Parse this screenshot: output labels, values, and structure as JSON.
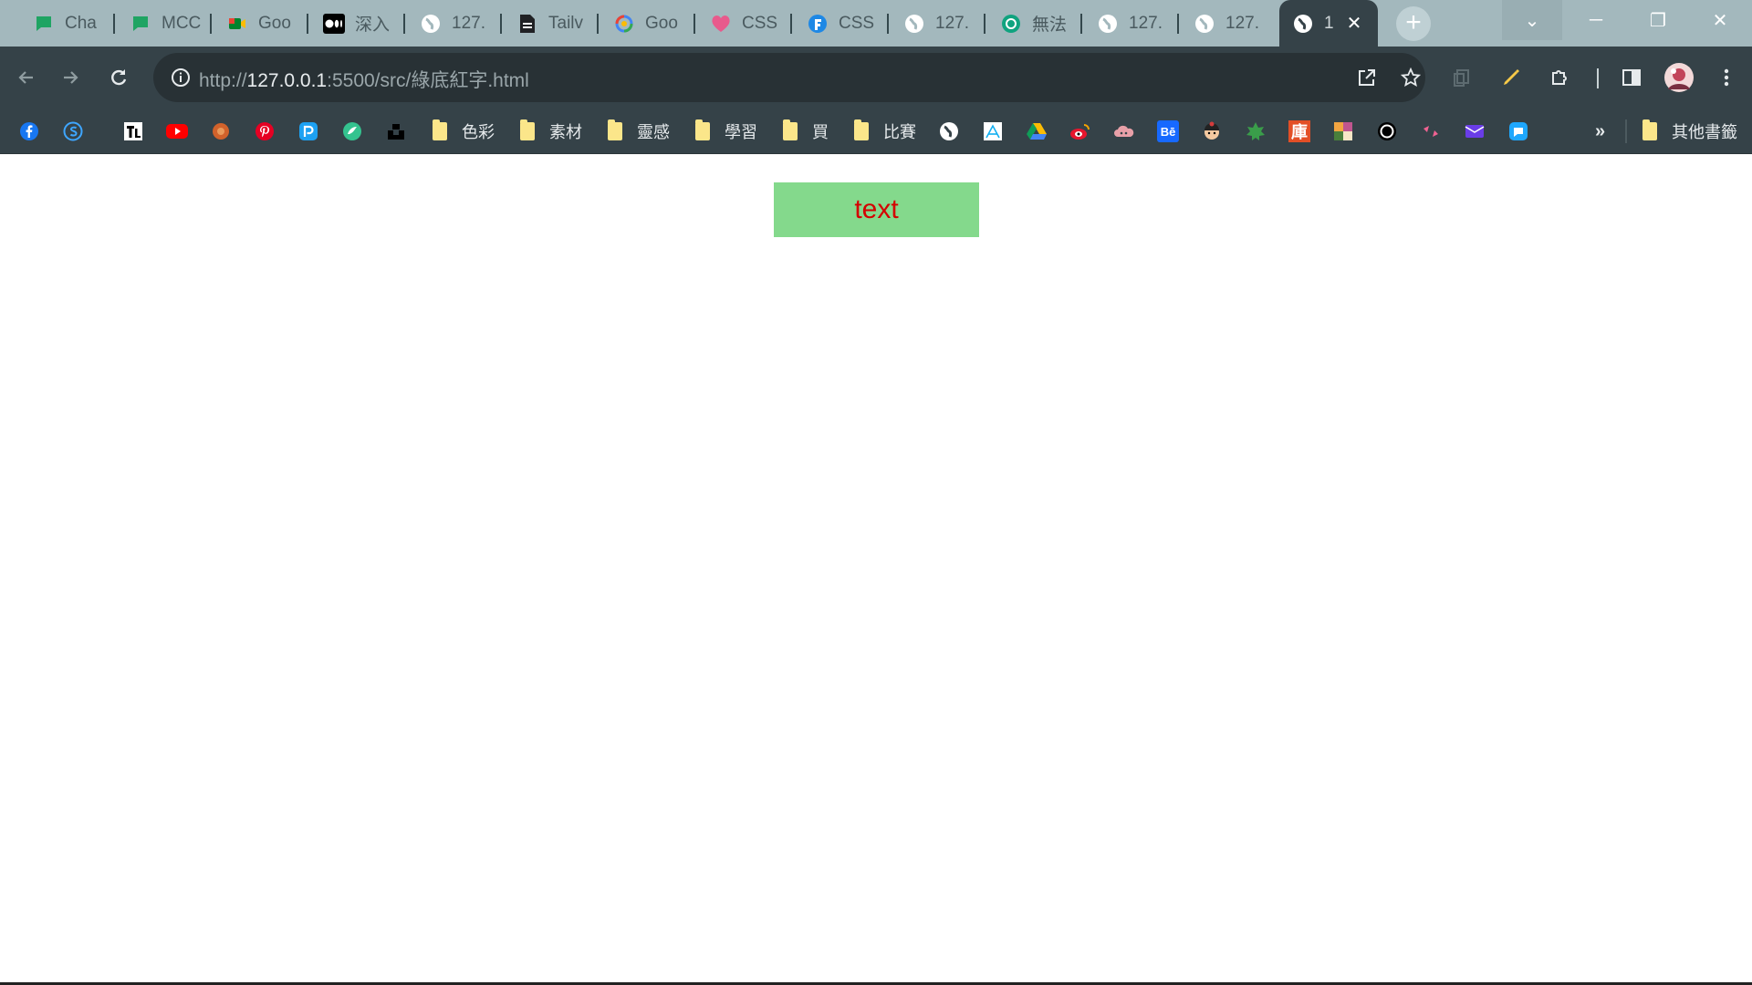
{
  "browser": {
    "tabs": [
      {
        "title": "Cha",
        "icon": "chat-icon",
        "icon_color": "#1fa463"
      },
      {
        "title": "MCC",
        "icon": "chat-icon",
        "icon_color": "#1fa463"
      },
      {
        "title": "Goo",
        "icon": "google-meet-icon",
        "icon_color": "#4285f4"
      },
      {
        "title": "深入",
        "icon": "medium-icon",
        "icon_color": "#000000"
      },
      {
        "title": "127.",
        "icon": "globe-icon",
        "icon_color": "#ffffff"
      },
      {
        "title": "Tailv",
        "icon": "document-icon",
        "icon_color": "#202124"
      },
      {
        "title": "Goo",
        "icon": "google-lens-icon",
        "icon_color": "#4285f4"
      },
      {
        "title": "CSS",
        "icon": "heart-icon",
        "icon_color": "#e85a8c"
      },
      {
        "title": "CSS",
        "icon": "f-logo-icon",
        "icon_color": "#1e88e5"
      },
      {
        "title": "127.",
        "icon": "globe-icon",
        "icon_color": "#ffffff"
      },
      {
        "title": "無法",
        "icon": "openai-icon",
        "icon_color": "#10a37f"
      },
      {
        "title": "127.",
        "icon": "globe-icon",
        "icon_color": "#ffffff"
      },
      {
        "title": "127.",
        "icon": "globe-icon",
        "icon_color": "#ffffff"
      },
      {
        "title": "1",
        "icon": "globe-icon",
        "icon_color": "#ffffff",
        "active": true
      }
    ],
    "active_tab_close": "✕",
    "new_tab_label": "+",
    "window_controls": {
      "tab_search": "⌄",
      "minimize": "─",
      "restore": "❐",
      "close": "✕"
    },
    "url": {
      "scheme": "http://",
      "host": "127.0.0.1",
      "rest": ":5500/src/綠底紅字.html"
    },
    "bookmarks": [
      {
        "icon": "facebook-icon",
        "label": "",
        "color": "#1877f2"
      },
      {
        "icon": "s-logo-icon",
        "label": "",
        "color": "#3ea6ff"
      },
      {
        "icon": "tl-logo-icon",
        "label": "",
        "color": "#ffffff"
      },
      {
        "icon": "youtube-icon",
        "label": "",
        "color": "#ff0000"
      },
      {
        "icon": "flower-icon",
        "label": "",
        "color": "#d1622b"
      },
      {
        "icon": "pinterest-icon",
        "label": "",
        "color": "#e60023"
      },
      {
        "icon": "p-logo-icon",
        "label": "",
        "color": "#1da1f2"
      },
      {
        "icon": "green-circle-icon",
        "label": "",
        "color": "#34c38f"
      },
      {
        "icon": "unsplash-icon",
        "label": "",
        "color": "#000000"
      },
      {
        "icon": "folder-icon",
        "label": "色彩"
      },
      {
        "icon": "folder-icon",
        "label": "素材"
      },
      {
        "icon": "folder-icon",
        "label": "靈感"
      },
      {
        "icon": "folder-icon",
        "label": "學習"
      },
      {
        "icon": "folder-icon",
        "label": "買"
      },
      {
        "icon": "folder-icon",
        "label": "比賽"
      },
      {
        "icon": "globe-icon",
        "label": "",
        "color": "#ffffff"
      },
      {
        "icon": "artstation-icon",
        "label": "",
        "color": "#ffffff"
      },
      {
        "icon": "google-drive-icon",
        "label": "",
        "color": "#fbbc04"
      },
      {
        "icon": "weibo-icon",
        "label": "",
        "color": "#e6162d"
      },
      {
        "icon": "cloud-icon",
        "label": "",
        "color": "#e8a0a8"
      },
      {
        "icon": "behance-icon",
        "label": "Bē",
        "color": "#1769ff"
      },
      {
        "icon": "character-icon",
        "label": "",
        "color": "#f4a261"
      },
      {
        "icon": "leaf-icon",
        "label": "",
        "color": "#3a9d4a"
      },
      {
        "icon": "library-icon",
        "label": "庫",
        "color": "#e34f26"
      },
      {
        "icon": "palette-icon",
        "label": "",
        "color": "#c0568f"
      },
      {
        "icon": "ring-icon",
        "label": "",
        "color": "#000000"
      },
      {
        "icon": "pink-arrows-icon",
        "label": "",
        "color": "#f06292"
      },
      {
        "icon": "mail-icon",
        "label": "",
        "color": "#6a3de8"
      },
      {
        "icon": "blue-chat-icon",
        "label": "",
        "color": "#1ea7fd"
      }
    ],
    "bookmarks_overflow": "»",
    "other_bookmarks": "其他書籤"
  },
  "page": {
    "demo_text": "text",
    "demo_bg": "#84d98c",
    "demo_color": "#d40000"
  }
}
